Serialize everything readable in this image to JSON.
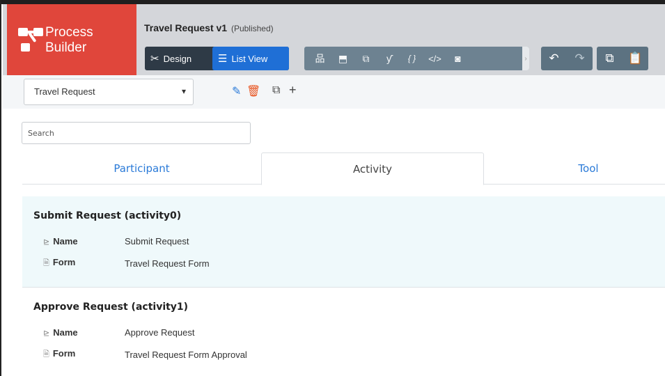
{
  "logo": {
    "line1": "Process",
    "line2": "Builder"
  },
  "header": {
    "title": "Travel Request v1",
    "status": "(Published)"
  },
  "view_toggle": {
    "design": {
      "label": "Design",
      "icon": "design-tools-icon"
    },
    "list_view": {
      "label": "List View",
      "icon": "list-icon",
      "active": true
    }
  },
  "tools": [
    {
      "name": "org-chart-icon",
      "glyph": "品"
    },
    {
      "name": "export-icon",
      "glyph": "⬒"
    },
    {
      "name": "import-icon",
      "glyph": "⧉"
    },
    {
      "name": "branch-icon",
      "glyph": "ƴ"
    },
    {
      "name": "json-icon",
      "glyph": "{ }"
    },
    {
      "name": "code-icon",
      "glyph": "</>"
    },
    {
      "name": "camera-icon",
      "glyph": "◙"
    }
  ],
  "process_select": {
    "value": "Travel Request"
  },
  "search": {
    "placeholder": "Search"
  },
  "tabs": [
    {
      "label": "Participant"
    },
    {
      "label": "Activity",
      "active": true
    },
    {
      "label": "Tool"
    }
  ],
  "activities": [
    {
      "title": "Submit Request (activity0)",
      "props": [
        {
          "key": "Name",
          "icon": "name-icon",
          "value": "Submit Request"
        },
        {
          "key": "Form",
          "icon": "form-icon",
          "value": "Travel Request Form"
        }
      ]
    },
    {
      "title": "Approve Request (activity1)",
      "props": [
        {
          "key": "Name",
          "icon": "name-icon",
          "value": "Approve Request"
        },
        {
          "key": "Form",
          "icon": "form-icon",
          "value": "Travel Request Form Approval"
        }
      ]
    }
  ],
  "colors": {
    "brand": "#e0463b",
    "accent": "#1f6fd6",
    "tab_link": "#2a7ad8",
    "highlight_row": "#eff9fb",
    "delete": "#e8531f"
  }
}
